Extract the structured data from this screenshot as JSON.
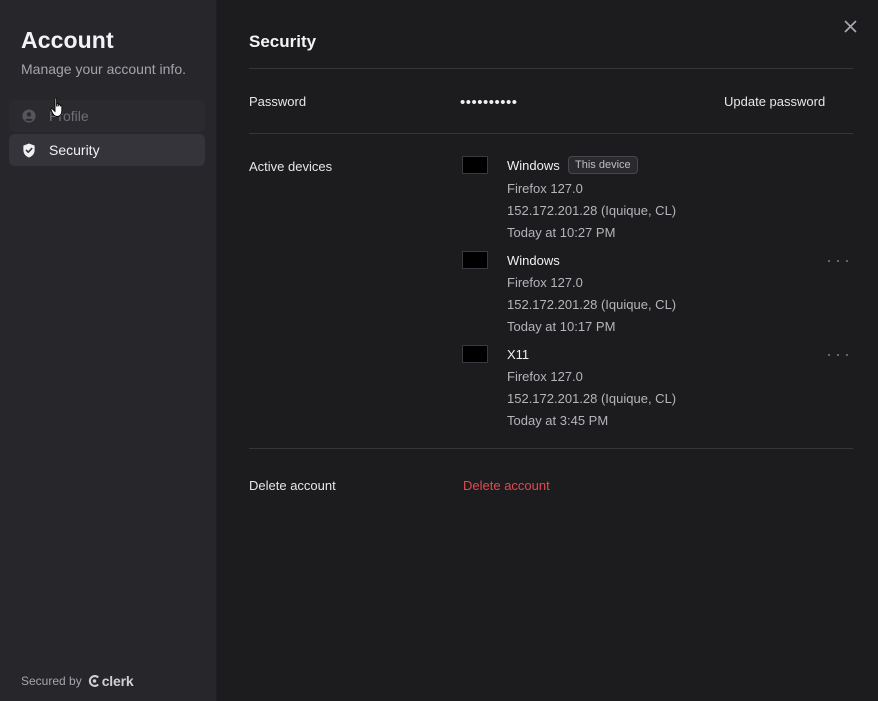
{
  "sidebar": {
    "title": "Account",
    "subtitle": "Manage your account info.",
    "items": [
      {
        "label": "Profile",
        "icon": "user-circle-icon"
      },
      {
        "label": "Security",
        "icon": "shield-icon"
      }
    ],
    "footer": {
      "secured_by": "Secured by",
      "brand": "clerk"
    }
  },
  "main": {
    "title": "Security",
    "password": {
      "label": "Password",
      "value": "••••••••••",
      "action": "Update password"
    },
    "devices": {
      "label": "Active devices",
      "items": [
        {
          "name": "Windows",
          "badge": "This device",
          "browser": "Firefox 127.0",
          "location": "152.172.201.28 (Iquique, CL)",
          "time": "Today at 10:27 PM"
        },
        {
          "name": "Windows",
          "badge": "",
          "browser": "Firefox 127.0",
          "location": "152.172.201.28 (Iquique, CL)",
          "time": "Today at 10:17 PM"
        },
        {
          "name": "X11",
          "badge": "",
          "browser": "Firefox 127.0",
          "location": "152.172.201.28 (Iquique, CL)",
          "time": "Today at 3:45 PM"
        }
      ]
    },
    "delete": {
      "label": "Delete account",
      "action": "Delete account"
    }
  },
  "colors": {
    "sidebar_bg": "#27272b",
    "main_bg": "#1c1c1f",
    "danger": "#e5484d",
    "active_nav": "#34343a"
  }
}
